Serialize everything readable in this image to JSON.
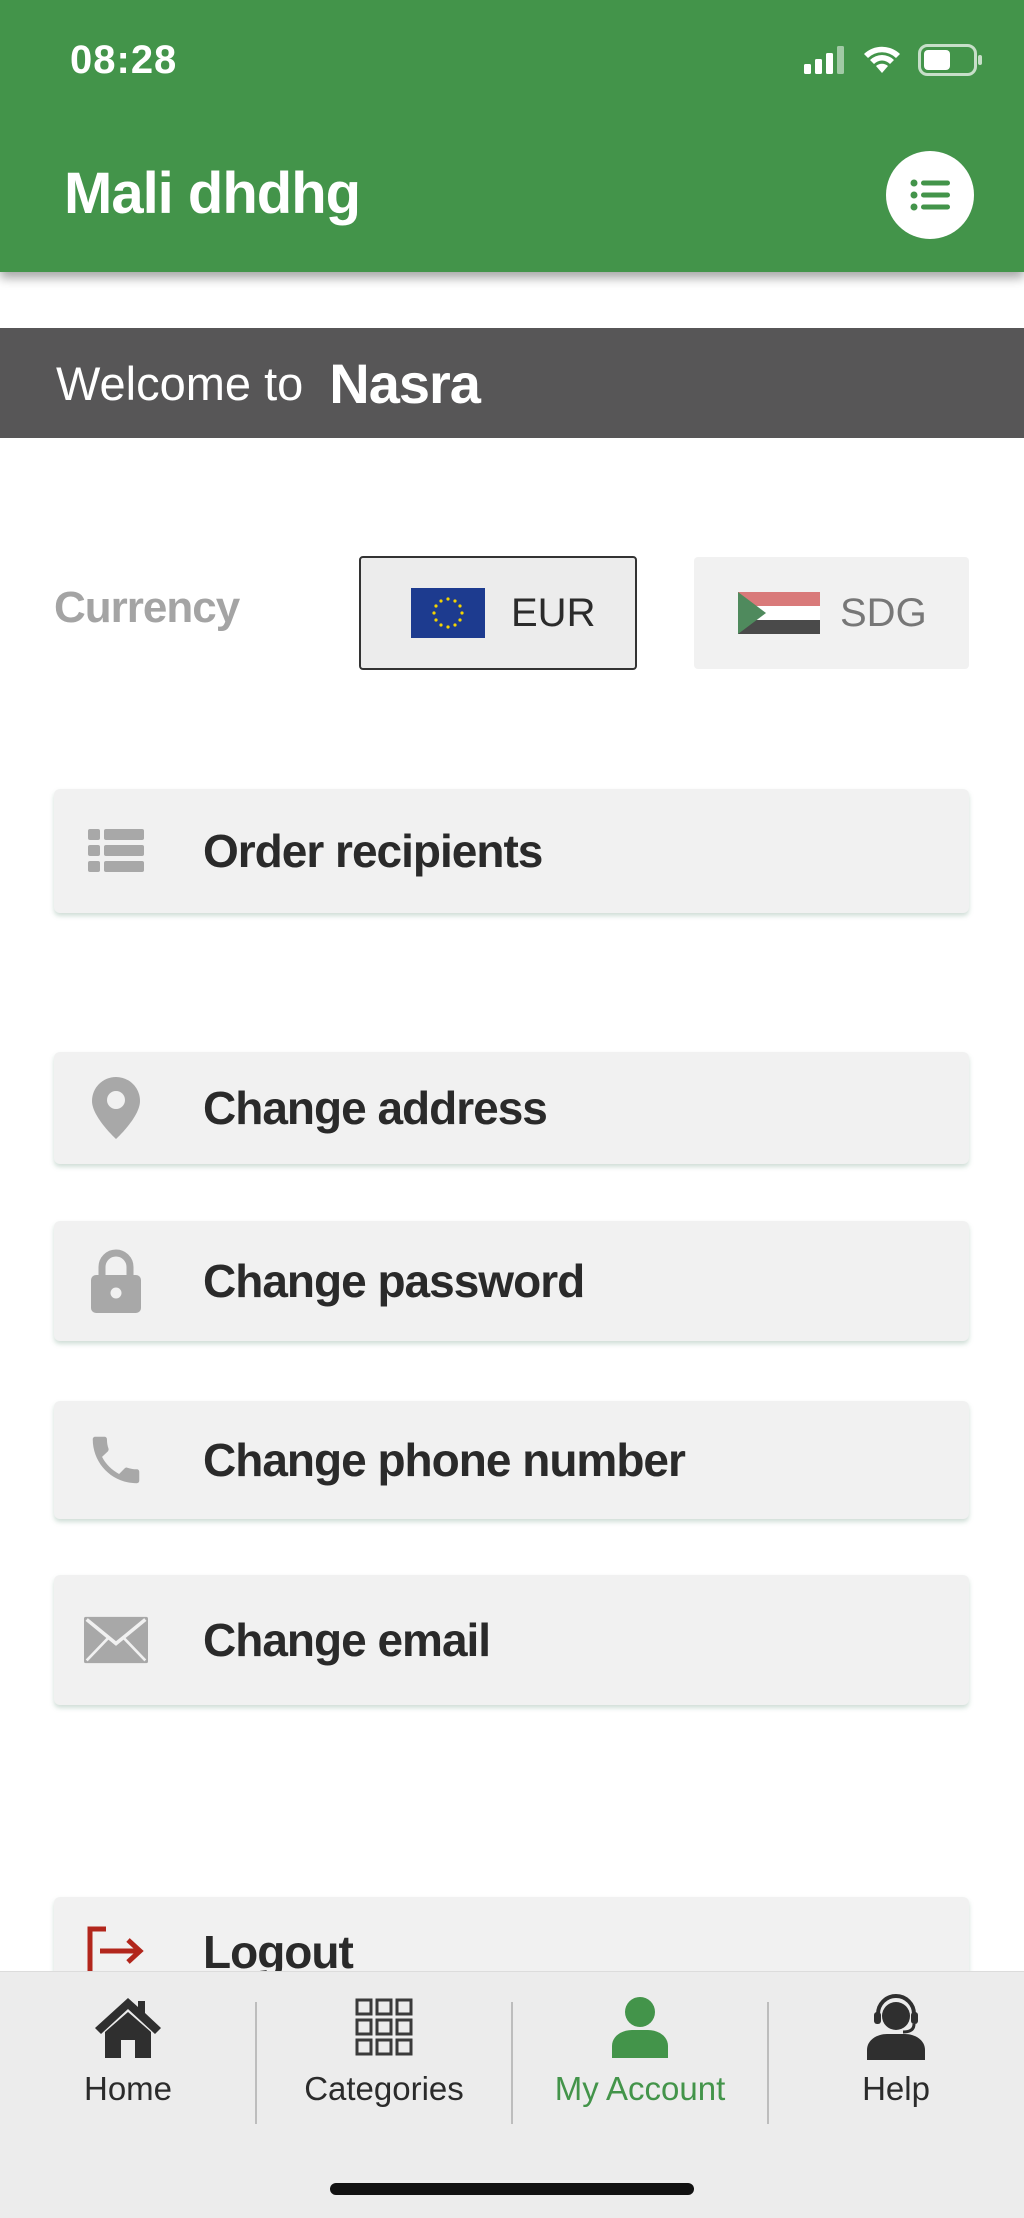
{
  "status_bar": {
    "time": "08:28"
  },
  "header": {
    "title": "Mali dhdhg"
  },
  "welcome": {
    "prefix": "Welcome to",
    "name": "Nasra"
  },
  "currency": {
    "label": "Currency",
    "options": [
      {
        "code": "EUR",
        "selected": true
      },
      {
        "code": "SDG",
        "selected": false
      }
    ]
  },
  "menu": [
    {
      "label": "Order recipients",
      "icon": "list-icon"
    },
    {
      "label": "Change address",
      "icon": "location-pin-icon"
    },
    {
      "label": "Change password",
      "icon": "lock-icon"
    },
    {
      "label": "Change phone number",
      "icon": "phone-icon"
    },
    {
      "label": "Change email",
      "icon": "envelope-icon"
    },
    {
      "label": "Logout",
      "icon": "logout-icon"
    }
  ],
  "bottom_nav": [
    {
      "label": "Home",
      "icon": "home-icon",
      "active": false
    },
    {
      "label": "Categories",
      "icon": "grid-icon",
      "active": false
    },
    {
      "label": "My Account",
      "icon": "user-icon",
      "active": true
    },
    {
      "label": "Help",
      "icon": "headset-icon",
      "active": false
    }
  ],
  "colors": {
    "primary": "#43944a",
    "banner": "#575657",
    "card": "#f1f1f1",
    "logout": "#b2261c"
  }
}
